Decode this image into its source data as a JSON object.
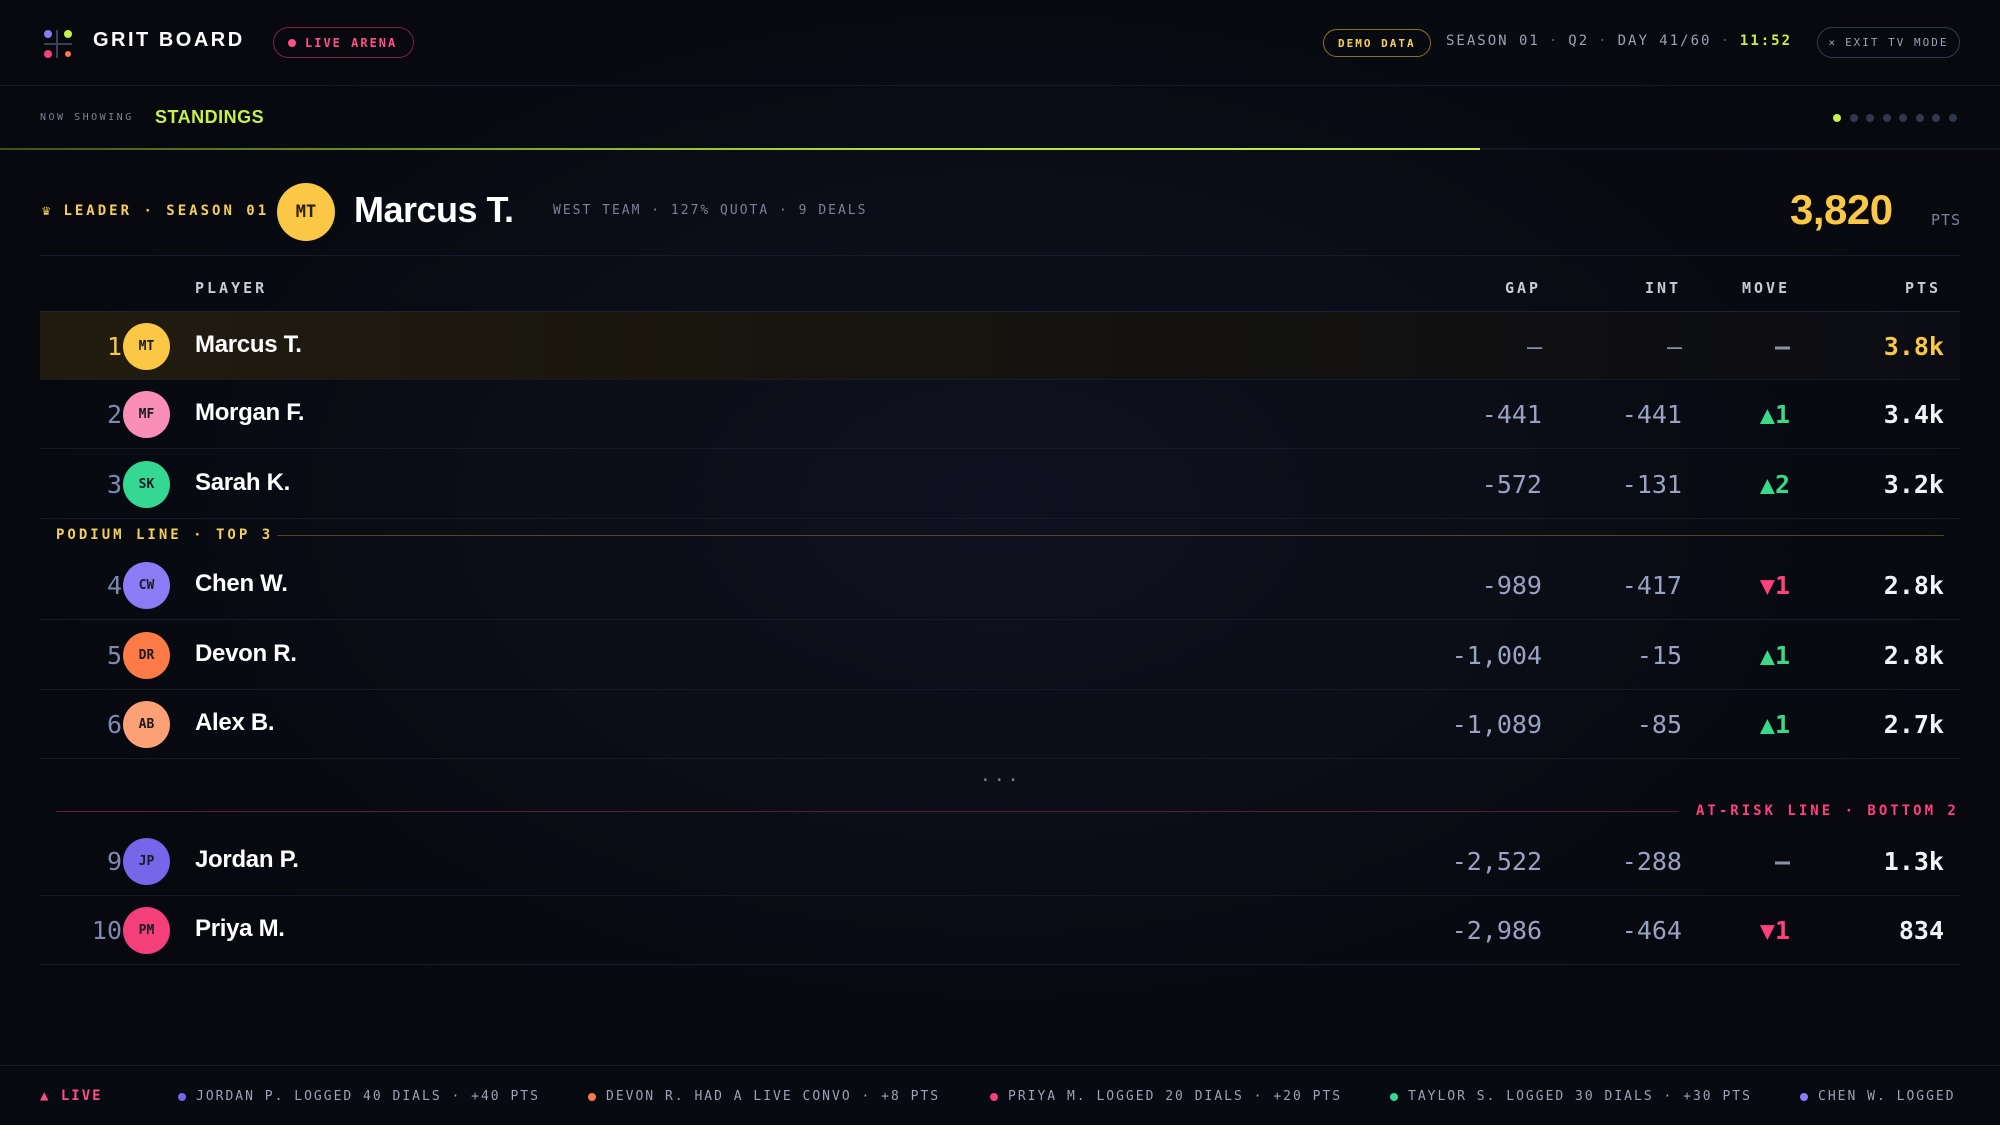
{
  "header": {
    "brand": "GRIT BOARD",
    "live_badge": "LIVE ARENA",
    "demo_badge": "DEMO DATA",
    "season": "SEASON 01",
    "quarter": "Q2",
    "day": "DAY 41/60",
    "clock": "11:52",
    "separator": "·",
    "exit_label": "EXIT TV MODE",
    "exit_glyph": "×"
  },
  "now_showing": {
    "label": "NOW SHOWING",
    "title": "STANDINGS",
    "pages_total": 8,
    "pages_active": 1,
    "progress_fraction": 0.74
  },
  "leader": {
    "tag": "LEADER · SEASON 01",
    "crown_icon": "♛",
    "initials": "MT",
    "name": "Marcus T.",
    "meta": "WEST TEAM · 127% QUOTA · 9 DEALS",
    "points": "3,820",
    "points_unit": "PTS"
  },
  "table": {
    "headers": {
      "player": "PLAYER",
      "gap": "GAP",
      "int": "INT",
      "move": "MOVE",
      "pts": "PTS"
    },
    "rows": [
      {
        "rank": "1",
        "initials": "MT",
        "name": "Marcus T.",
        "gap": "—",
        "int": "—",
        "move": "–",
        "pts": "3.8k"
      },
      {
        "rank": "2",
        "initials": "MF",
        "name": "Morgan F.",
        "gap": "-441",
        "int": "-441",
        "move": "▲1",
        "pts": "3.4k"
      },
      {
        "rank": "3",
        "initials": "SK",
        "name": "Sarah K.",
        "gap": "-572",
        "int": "-131",
        "move": "▲2",
        "pts": "3.2k"
      },
      {
        "rank": "4",
        "initials": "CW",
        "name": "Chen W.",
        "gap": "-989",
        "int": "-417",
        "move": "▼1",
        "pts": "2.8k"
      },
      {
        "rank": "5",
        "initials": "DR",
        "name": "Devon R.",
        "gap": "-1,004",
        "int": "-15",
        "move": "▲1",
        "pts": "2.8k"
      },
      {
        "rank": "6",
        "initials": "AB",
        "name": "Alex B.",
        "gap": "-1,089",
        "int": "-85",
        "move": "▲1",
        "pts": "2.7k"
      },
      {
        "rank": "9",
        "initials": "JP",
        "name": "Jordan P.",
        "gap": "-2,522",
        "int": "-288",
        "move": "–",
        "pts": "1.3k"
      },
      {
        "rank": "10",
        "initials": "PM",
        "name": "Priya M.",
        "gap": "-2,986",
        "int": "-464",
        "move": "▼1",
        "pts": "834"
      }
    ],
    "podium_label": "PODIUM LINE · TOP 3",
    "ellipsis": "...",
    "risk_label": "AT-RISK LINE · BOTTOM 2"
  },
  "colors": {
    "accent": "#c8f04a",
    "gold": "#fac845",
    "up": "#3ad98a",
    "down": "#ff3f7e",
    "avatar_MT": "#fac845",
    "avatar_MF": "#f98fb7",
    "avatar_SK": "#34d893",
    "avatar_CW": "#8b7cf6",
    "avatar_DR": "#fb7a45",
    "avatar_AB": "#fca175",
    "avatar_JP": "#7566ea",
    "avatar_PM": "#f43f7a"
  },
  "ticker": {
    "live_label": "▲ LIVE",
    "items": [
      {
        "text": "JORDAN P. LOGGED 40 DIALS · +40 PTS",
        "color": "#7566ea"
      },
      {
        "text": "DEVON R. HAD A LIVE CONVO · +8 PTS",
        "color": "#fb7a45"
      },
      {
        "text": "PRIYA M. LOGGED 20 DIALS · +20 PTS",
        "color": "#f43f7a"
      },
      {
        "text": "TAYLOR S. LOGGED 30 DIALS · +30 PTS",
        "color": "#34d893"
      },
      {
        "text": "CHEN W. LOGGED",
        "color": "#8b7cf6"
      }
    ]
  }
}
